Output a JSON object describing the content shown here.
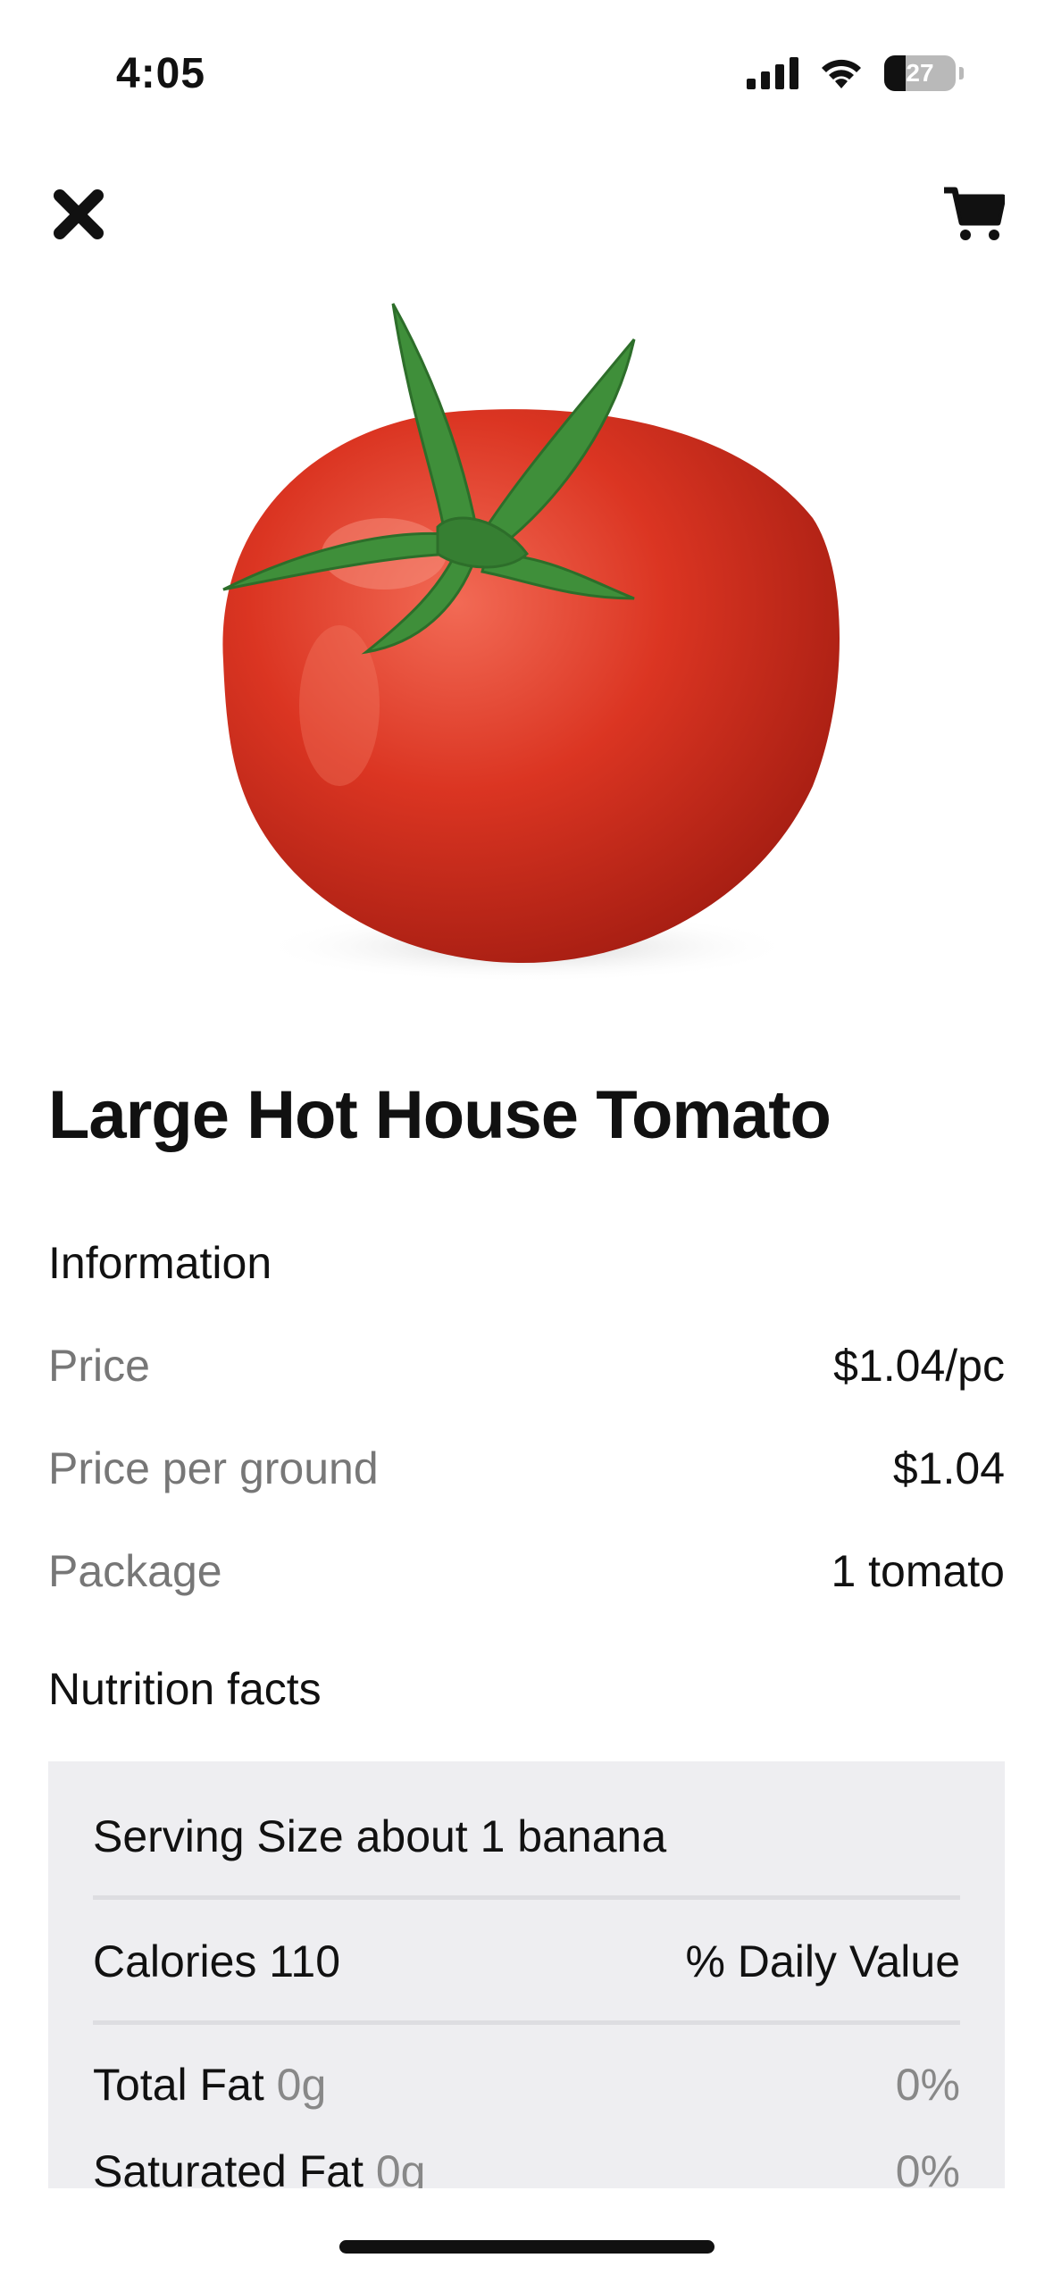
{
  "status_bar": {
    "time": "4:05",
    "battery": "27"
  },
  "header": {
    "close_icon": "close-icon",
    "cart_icon": "cart-icon"
  },
  "product": {
    "name": "Large Hot House Tomato",
    "image": "tomato-image"
  },
  "information": {
    "section_title": "Information",
    "rows": [
      {
        "label": "Price",
        "value": "$1.04/pc"
      },
      {
        "label": "Price per ground",
        "value": "$1.04"
      },
      {
        "label": "Package",
        "value": "1 tomato"
      }
    ]
  },
  "nutrition": {
    "section_title": "Nutrition facts",
    "serving_size": "Serving Size about 1 banana",
    "calories": "Calories 110",
    "daily_value_header": "% Daily Value",
    "items": [
      {
        "name": "Total Fat",
        "amount": "0g",
        "percent": "0%"
      },
      {
        "name": "Saturated Fat",
        "amount": "0g",
        "percent": "0%"
      }
    ]
  },
  "colors": {
    "background": "#ffffff",
    "card": "#eeeef1",
    "muted_text": "#777777",
    "tomato_red": "#d8311f",
    "stem_green": "#3f8f3a"
  }
}
